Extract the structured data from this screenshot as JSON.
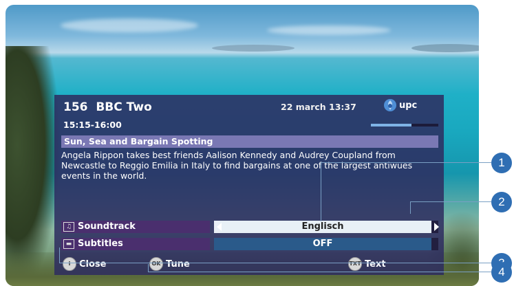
{
  "channel": {
    "number": "156",
    "name": "BBC Two"
  },
  "datetime": "22 march 13:37",
  "brand": {
    "name": "upc",
    "icon": "upc-logo-icon"
  },
  "timeslot": "15:15-16:00",
  "progress": 0.6,
  "program": {
    "title": "Sun, Sea and Bargain Spotting",
    "description": "Angela Rippon takes best friends Aalison Kennedy and Audrey Coupland from Newcastle to Reggio Emilia in Italy to find bargains at one of the largest antiwues events in the world."
  },
  "settings": [
    {
      "label": "Soundtrack",
      "icon": "soundtrack-icon",
      "value": "Englisch"
    },
    {
      "label": "Subtitles",
      "icon": "subtitles-icon",
      "value": "OFF"
    }
  ],
  "footer": [
    {
      "label": "Close",
      "icon": "info-button-icon",
      "glyph": "i"
    },
    {
      "label": "Tune",
      "icon": "ok-button-icon",
      "glyph": "OK"
    },
    {
      "label": "Text",
      "icon": "txt-button-icon",
      "glyph": "TXT"
    }
  ],
  "callouts": [
    "1",
    "2",
    "3",
    "4"
  ],
  "colors": {
    "panel": "#2d2c60",
    "title_bar": "#7a78b4",
    "callout": "#2f6eb3",
    "selected_field": "#e8f0f6"
  }
}
